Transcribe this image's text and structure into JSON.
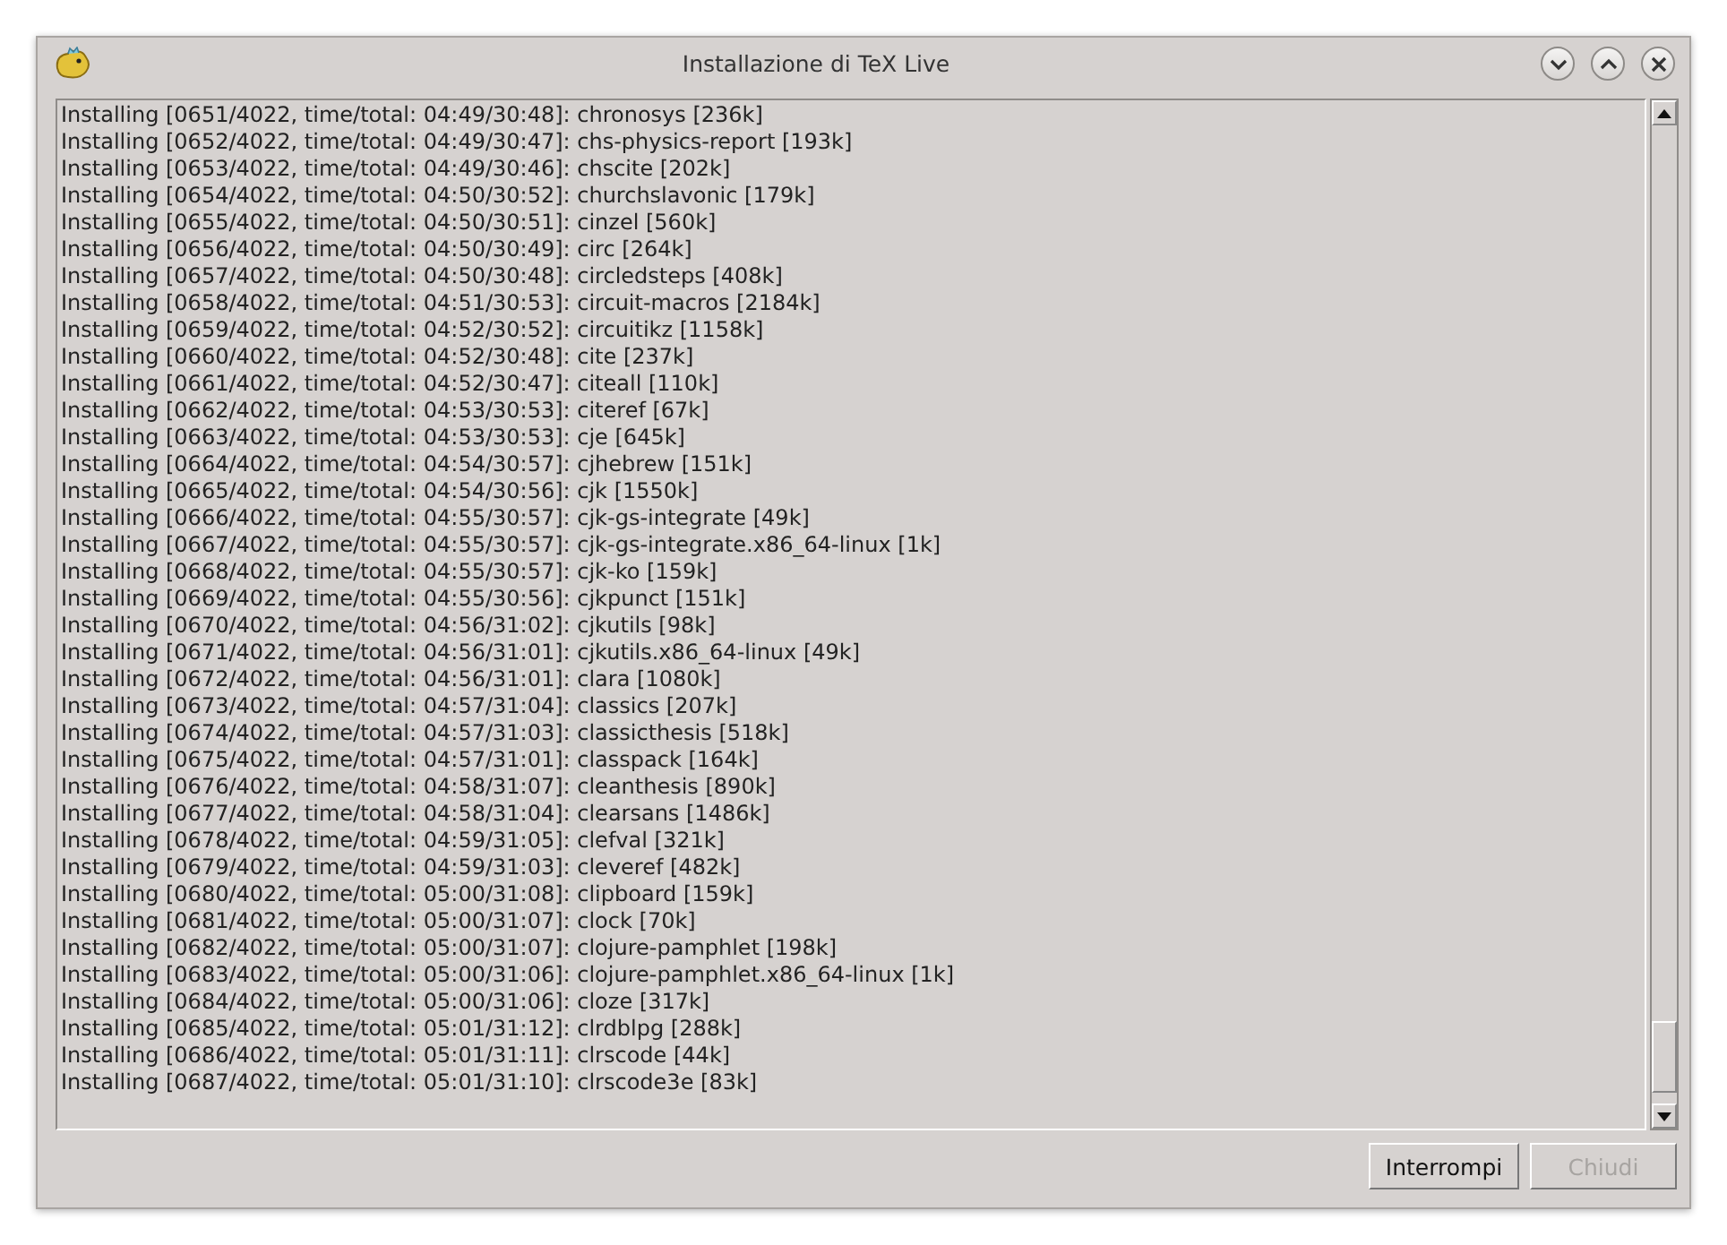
{
  "window": {
    "title": "Installazione di TeX Live"
  },
  "log_lines": [
    "Installing [0651/4022, time/total: 04:49/30:48]: chronosys [236k]",
    "Installing [0652/4022, time/total: 04:49/30:47]: chs-physics-report [193k]",
    "Installing [0653/4022, time/total: 04:49/30:46]: chscite [202k]",
    "Installing [0654/4022, time/total: 04:50/30:52]: churchslavonic [179k]",
    "Installing [0655/4022, time/total: 04:50/30:51]: cinzel [560k]",
    "Installing [0656/4022, time/total: 04:50/30:49]: circ [264k]",
    "Installing [0657/4022, time/total: 04:50/30:48]: circledsteps [408k]",
    "Installing [0658/4022, time/total: 04:51/30:53]: circuit-macros [2184k]",
    "Installing [0659/4022, time/total: 04:52/30:52]: circuitikz [1158k]",
    "Installing [0660/4022, time/total: 04:52/30:48]: cite [237k]",
    "Installing [0661/4022, time/total: 04:52/30:47]: citeall [110k]",
    "Installing [0662/4022, time/total: 04:53/30:53]: citeref [67k]",
    "Installing [0663/4022, time/total: 04:53/30:53]: cje [645k]",
    "Installing [0664/4022, time/total: 04:54/30:57]: cjhebrew [151k]",
    "Installing [0665/4022, time/total: 04:54/30:56]: cjk [1550k]",
    "Installing [0666/4022, time/total: 04:55/30:57]: cjk-gs-integrate [49k]",
    "Installing [0667/4022, time/total: 04:55/30:57]: cjk-gs-integrate.x86_64-linux [1k]",
    "Installing [0668/4022, time/total: 04:55/30:57]: cjk-ko [159k]",
    "Installing [0669/4022, time/total: 04:55/30:56]: cjkpunct [151k]",
    "Installing [0670/4022, time/total: 04:56/31:02]: cjkutils [98k]",
    "Installing [0671/4022, time/total: 04:56/31:01]: cjkutils.x86_64-linux [49k]",
    "Installing [0672/4022, time/total: 04:56/31:01]: clara [1080k]",
    "Installing [0673/4022, time/total: 04:57/31:04]: classics [207k]",
    "Installing [0674/4022, time/total: 04:57/31:03]: classicthesis [518k]",
    "Installing [0675/4022, time/total: 04:57/31:01]: classpack [164k]",
    "Installing [0676/4022, time/total: 04:58/31:07]: cleanthesis [890k]",
    "Installing [0677/4022, time/total: 04:58/31:04]: clearsans [1486k]",
    "Installing [0678/4022, time/total: 04:59/31:05]: clefval [321k]",
    "Installing [0679/4022, time/total: 04:59/31:03]: cleveref [482k]",
    "Installing [0680/4022, time/total: 05:00/31:08]: clipboard [159k]",
    "Installing [0681/4022, time/total: 05:00/31:07]: clock [70k]",
    "Installing [0682/4022, time/total: 05:00/31:07]: clojure-pamphlet [198k]",
    "Installing [0683/4022, time/total: 05:00/31:06]: clojure-pamphlet.x86_64-linux [1k]",
    "Installing [0684/4022, time/total: 05:00/31:06]: cloze [317k]",
    "Installing [0685/4022, time/total: 05:01/31:12]: clrdblpg [288k]",
    "Installing [0686/4022, time/total: 05:01/31:11]: clrscode [44k]",
    "Installing [0687/4022, time/total: 05:01/31:10]: clrscode3e [83k]"
  ],
  "buttons": [
    {
      "label": "Interrompi",
      "disabled": false
    },
    {
      "label": "Chiudi",
      "disabled": true
    }
  ]
}
